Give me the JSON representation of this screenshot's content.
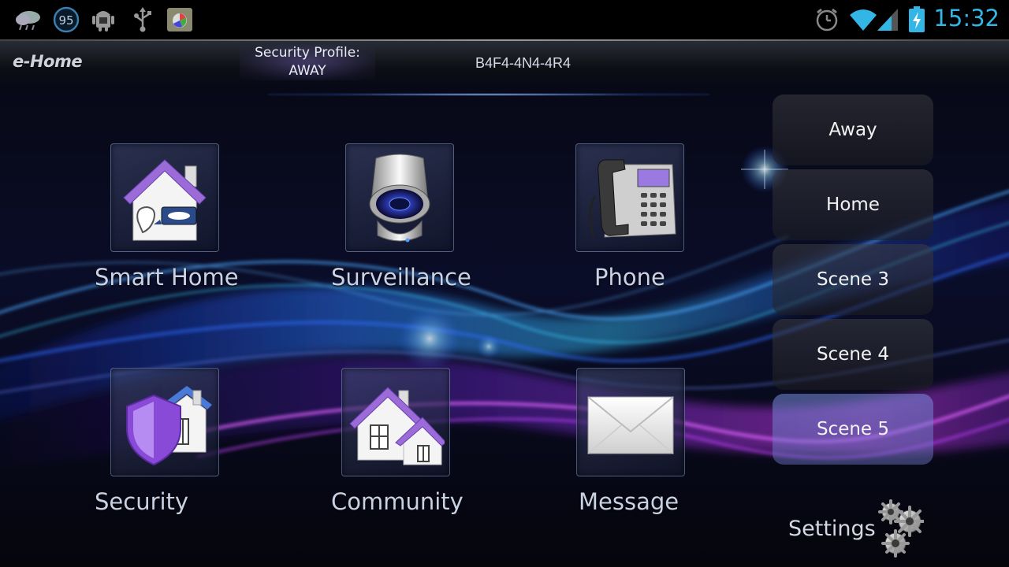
{
  "statusbar": {
    "weather_temp": "95",
    "time": "15:32",
    "icons": [
      "weather-icon",
      "temperature-badge",
      "android-debug-icon",
      "usb-icon",
      "app-notification-icon",
      "alarm-icon",
      "wifi-icon",
      "signal-icon",
      "battery-charging-icon"
    ]
  },
  "header": {
    "logo": "e-Home",
    "profile_label": "Security Profile:",
    "profile_value": "AWAY",
    "device_id": "B4F4-4N4-4R4"
  },
  "apps": [
    {
      "label": "Smart Home",
      "icon": "smart-home-icon"
    },
    {
      "label": "Surveillance",
      "icon": "camera-icon"
    },
    {
      "label": "Phone",
      "icon": "phone-icon"
    },
    {
      "label": "Security",
      "icon": "shield-house-icon"
    },
    {
      "label": "Community",
      "icon": "community-houses-icon"
    },
    {
      "label": "Message",
      "icon": "envelope-icon"
    }
  ],
  "scenes": [
    "Away",
    "Home",
    "Scene 3",
    "Scene 4",
    "Scene 5"
  ],
  "active_scene": "Scene 5",
  "settings": {
    "label": "Settings",
    "icon": "gears-icon"
  },
  "colors": {
    "accent_time": "#33b5e5",
    "active_scene": "#7a88d4"
  }
}
